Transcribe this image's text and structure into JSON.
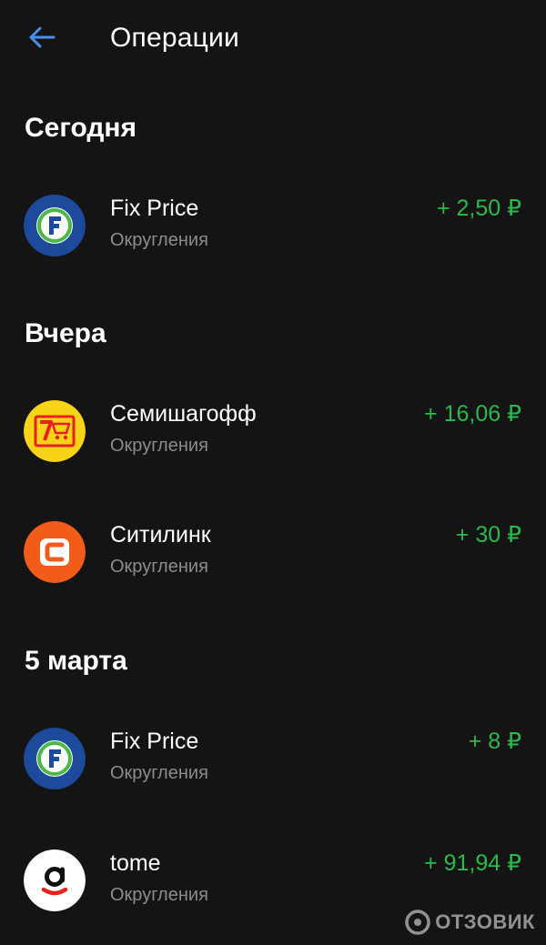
{
  "header": {
    "title": "Операции"
  },
  "sections": [
    {
      "title": "Сегодня",
      "items": [
        {
          "name": "Fix Price",
          "subtitle": "Округления",
          "amount": "+ 2,50 ₽",
          "logo": "fix-price-logo"
        }
      ]
    },
    {
      "title": "Вчера",
      "items": [
        {
          "name": "Семишагофф",
          "subtitle": "Округления",
          "amount": "+ 16,06 ₽",
          "logo": "semishagoff-logo"
        },
        {
          "name": "Ситилинк",
          "subtitle": "Округления",
          "amount": "+ 30 ₽",
          "logo": "citilink-logo"
        }
      ]
    },
    {
      "title": "5 марта",
      "items": [
        {
          "name": "Fix Price",
          "subtitle": "Округления",
          "amount": "+ 8 ₽",
          "logo": "fix-price-logo"
        },
        {
          "name": "tome",
          "subtitle": "Округления",
          "amount": "+ 91,94 ₽",
          "logo": "tome-logo"
        }
      ]
    }
  ],
  "watermark": {
    "text": "ОТЗОВИК"
  },
  "colors": {
    "background": "#141414",
    "accent_back": "#4a8ef0",
    "amount_positive": "#2db84d",
    "subtitle": "#8c8c8c",
    "fixprice_blue": "#1d4a9a",
    "fixprice_green": "#4db848",
    "semishagoff_yellow": "#f7d417",
    "semishagoff_red": "#e42320",
    "citilink_orange": "#f25c19"
  }
}
